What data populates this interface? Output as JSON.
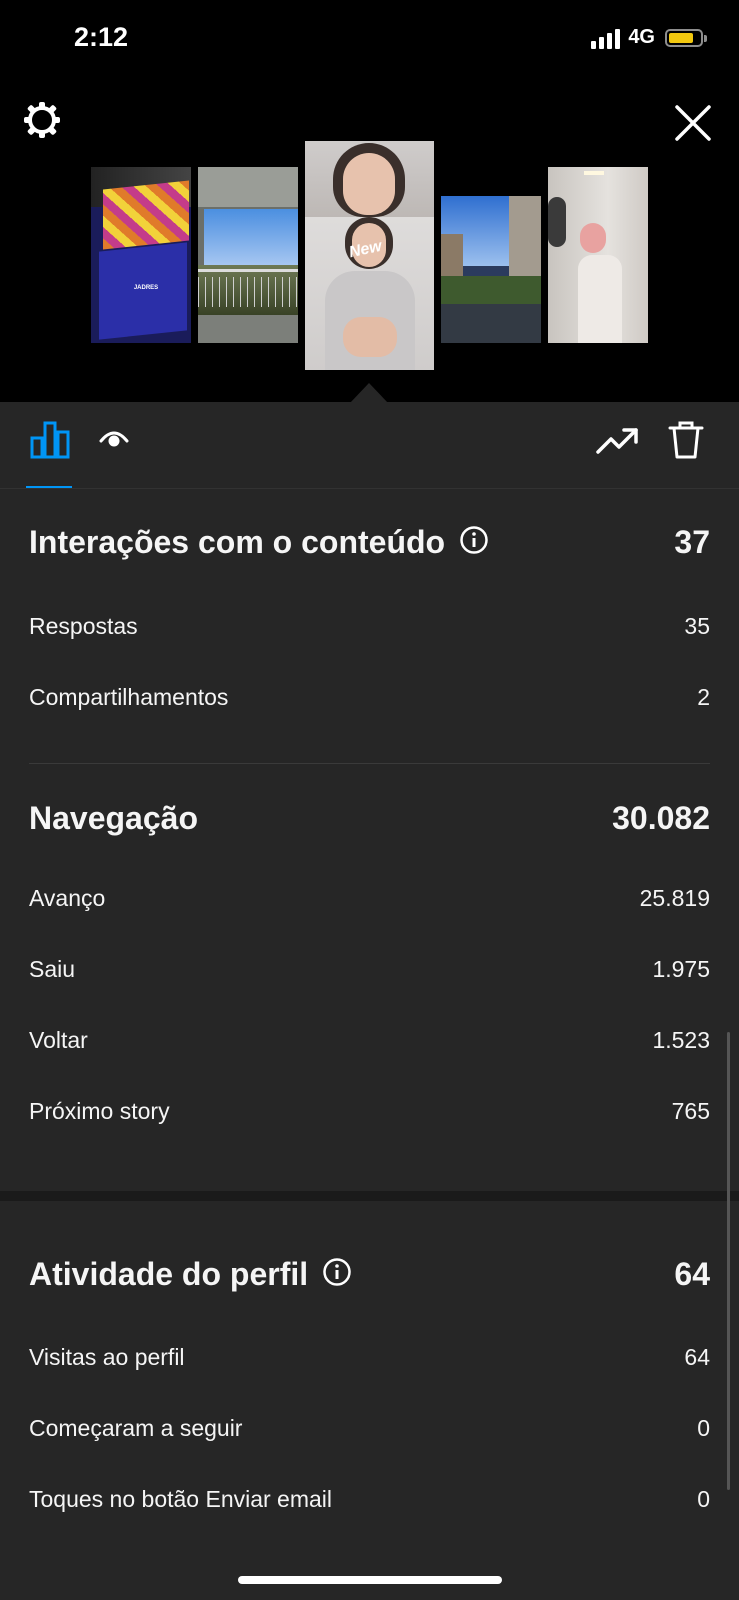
{
  "status": {
    "time": "2:12",
    "network": "4G",
    "battery_color": "#f2c80f"
  },
  "header": {
    "settings_icon": "gear-icon",
    "close_icon": "close-icon"
  },
  "stories": [
    {
      "caption": "JADRES"
    },
    {
      "caption": ""
    },
    {
      "badge": "New",
      "selected": true
    },
    {
      "caption": ""
    },
    {
      "caption": ""
    }
  ],
  "tabs": [
    {
      "name": "bar-chart-icon",
      "active": true
    },
    {
      "name": "eye-icon",
      "active": false
    }
  ],
  "actions": [
    {
      "name": "trending-up-icon"
    },
    {
      "name": "trash-icon"
    }
  ],
  "interactions": {
    "title": "Interações com o conteúdo",
    "total": "37",
    "rows": [
      {
        "label": "Respostas",
        "value": "35"
      },
      {
        "label": "Compartilhamentos",
        "value": "2"
      }
    ]
  },
  "navigation": {
    "title": "Navegação",
    "total": "30.082",
    "rows": [
      {
        "label": "Avanço",
        "value": "25.819"
      },
      {
        "label": "Saiu",
        "value": "1.975"
      },
      {
        "label": "Voltar",
        "value": "1.523"
      },
      {
        "label": "Próximo story",
        "value": "765"
      }
    ]
  },
  "profile_activity": {
    "title": "Atividade do perfil",
    "total": "64",
    "rows": [
      {
        "label": "Visitas ao perfil",
        "value": "64"
      },
      {
        "label": "Começaram a seguir",
        "value": "0"
      },
      {
        "label": "Toques no botão Enviar email",
        "value": "0"
      }
    ]
  },
  "colors": {
    "accent": "#0095f6",
    "background": "#262626",
    "header_bg": "#000000"
  }
}
